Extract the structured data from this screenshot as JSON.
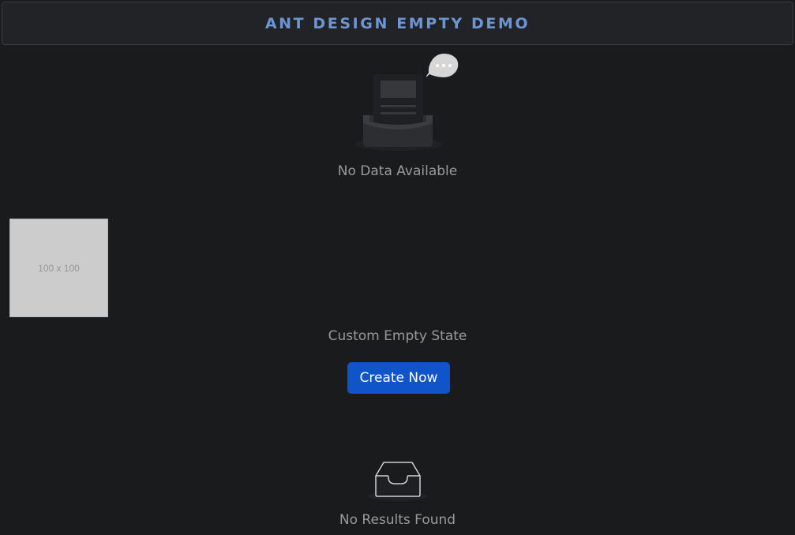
{
  "header": {
    "title": "ANT DESIGN EMPTY DEMO"
  },
  "default_empty": {
    "icon": "empty-inbox-illustration-icon",
    "description": "No Data Available"
  },
  "custom_empty": {
    "image_label": "100 x 100",
    "description": "Custom Empty State",
    "button_label": "Create Now"
  },
  "simple_empty": {
    "icon": "empty-tray-icon",
    "description": "No Results Found"
  },
  "colors": {
    "background": "#1a1b1d",
    "header_text": "#6c95d4",
    "primary_button": "#0f54c9",
    "description_text": "#9a9a9a"
  }
}
